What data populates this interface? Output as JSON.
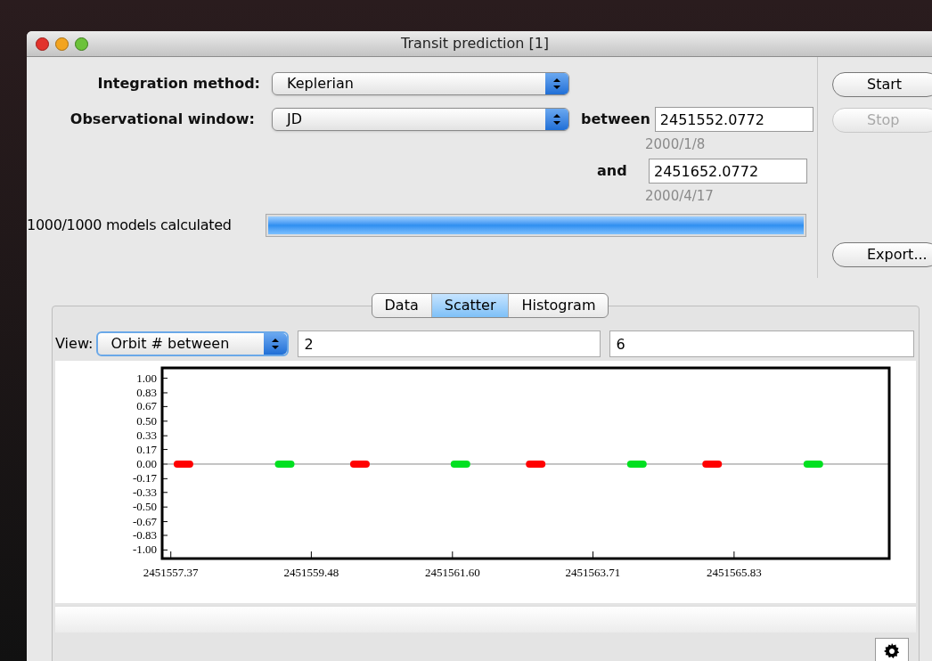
{
  "window": {
    "title": "Transit prediction [1]"
  },
  "form": {
    "integration_method": {
      "label": "Integration method:",
      "value": "Keplerian"
    },
    "observational_window": {
      "label": "Observational window:",
      "value": "JD"
    },
    "start": {
      "label": "between",
      "value": "2451552.0772",
      "date": "2000/1/8"
    },
    "end": {
      "label": "and",
      "value": "2451652.0772",
      "date": "2000/4/17"
    },
    "progress": {
      "label": "1000/1000 models calculated",
      "level": 1
    }
  },
  "buttons": [
    {
      "label": "Start",
      "disabled": false
    },
    {
      "label": "Stop",
      "disabled": true
    }
  ],
  "export_button": {
    "label": "Export...",
    "disabled": false
  },
  "tabs": [
    {
      "label": "Data",
      "selected": false
    },
    {
      "label": "Scatter",
      "selected": true
    },
    {
      "label": "Histogram",
      "selected": false
    }
  ],
  "view": {
    "label": "View:",
    "value": "Orbit # between",
    "from": "2",
    "to": "6"
  },
  "chart_data": {
    "type": "scatter",
    "xlim": [
      2451557.24,
      2451568.16
    ],
    "ylim": [
      -1.1,
      1.12
    ],
    "x": [
      2451557.56,
      2451559.08,
      2451560.21,
      2451561.72,
      2451562.85,
      2451564.37,
      2451565.5,
      2451567.02
    ],
    "series": [
      {
        "color": "#ff0000",
        "values": [
          0,
          null,
          0,
          null,
          0,
          null,
          0,
          null
        ]
      },
      {
        "color": "#00e020",
        "values": [
          null,
          0,
          null,
          0,
          null,
          0,
          null,
          0
        ]
      }
    ],
    "xticks": [
      {
        "value": 2451557.37,
        "label": "2451557.37"
      },
      {
        "value": 2451559.48,
        "label": "2451559.48"
      },
      {
        "value": 2451561.6,
        "label": "2451561.60"
      },
      {
        "value": 2451563.71,
        "label": "2451563.71"
      },
      {
        "value": 2451565.83,
        "label": "2451565.83"
      }
    ],
    "yticks": [
      {
        "value": 1,
        "label": "1.00"
      },
      {
        "value": 0.83,
        "label": "0.83"
      },
      {
        "value": 0.67,
        "label": "0.67"
      },
      {
        "value": 0.5,
        "label": "0.50"
      },
      {
        "value": 0.33,
        "label": "0.33"
      },
      {
        "value": 0.17,
        "label": "0.17"
      },
      {
        "value": 0,
        "label": "0.00"
      },
      {
        "value": -0.17,
        "label": "-0.17"
      },
      {
        "value": -0.33,
        "label": "-0.33"
      },
      {
        "value": -0.5,
        "label": "-0.50"
      },
      {
        "value": -0.67,
        "label": "-0.67"
      },
      {
        "value": -0.83,
        "label": "-0.83"
      },
      {
        "value": -1,
        "label": "-1.00"
      }
    ]
  }
}
